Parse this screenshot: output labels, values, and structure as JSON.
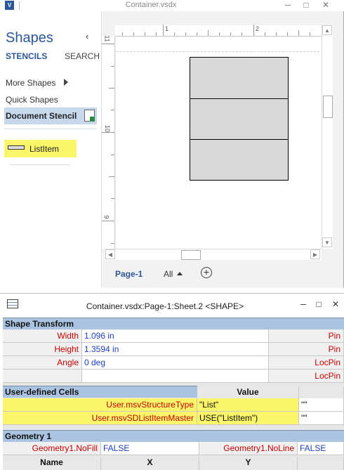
{
  "window": {
    "title": "Container.vsdx",
    "app_icon": "V",
    "controls": [
      "─",
      "□",
      "✕"
    ]
  },
  "shapes_pane": {
    "title": "Shapes",
    "collapse_glyph": "‹",
    "tab_stencils": "STENCILS",
    "tab_search": "SEARCH",
    "more_shapes": "More Shapes",
    "quick_shapes": "Quick Shapes",
    "document_stencil": "Document Stencil",
    "master_item": "ListItem"
  },
  "canvas": {
    "ruler_h_labels": [
      "1",
      "2"
    ],
    "ruler_v_labels": [
      "11",
      "10",
      "9"
    ],
    "scroll_up": "▲",
    "scroll_down": "▼",
    "scroll_left": "◀",
    "scroll_right": "▶",
    "list_rows": 3
  },
  "page_tabs": {
    "active": "Page-1",
    "all": "All",
    "add": "+"
  },
  "shapesheet": {
    "title": "Container.vsdx:Page-1:Sheet.2 <SHAPE>",
    "controls": [
      "─",
      "□",
      "✕"
    ],
    "shape_transform": {
      "header": "Shape Transform",
      "rows": [
        {
          "name": "Width",
          "value": "1.096 in",
          "right": "Pin"
        },
        {
          "name": "Height",
          "value": "1.3594 in",
          "right": "Pin"
        },
        {
          "name": "Angle",
          "value": "0 deg",
          "right": "LocPin"
        },
        {
          "name": "",
          "value": "",
          "right": "LocPin"
        }
      ]
    },
    "user_defined": {
      "header": "User-defined Cells",
      "value_header": "Value",
      "rows": [
        {
          "name": "User.msvStructureType",
          "value": "\"List\"",
          "extra": "\"\""
        },
        {
          "name": "User.msvSDListItemMaster",
          "value": "USE(\"ListItem\")",
          "extra": "\"\""
        }
      ]
    },
    "geometry": {
      "header": "Geometry 1",
      "nofill_name": "Geometry1.NoFill",
      "nofill_value": "FALSE",
      "noline_name": "Geometry1.NoLine",
      "noline_value": "FALSE",
      "columns": [
        "Name",
        "X",
        "Y"
      ]
    }
  }
}
